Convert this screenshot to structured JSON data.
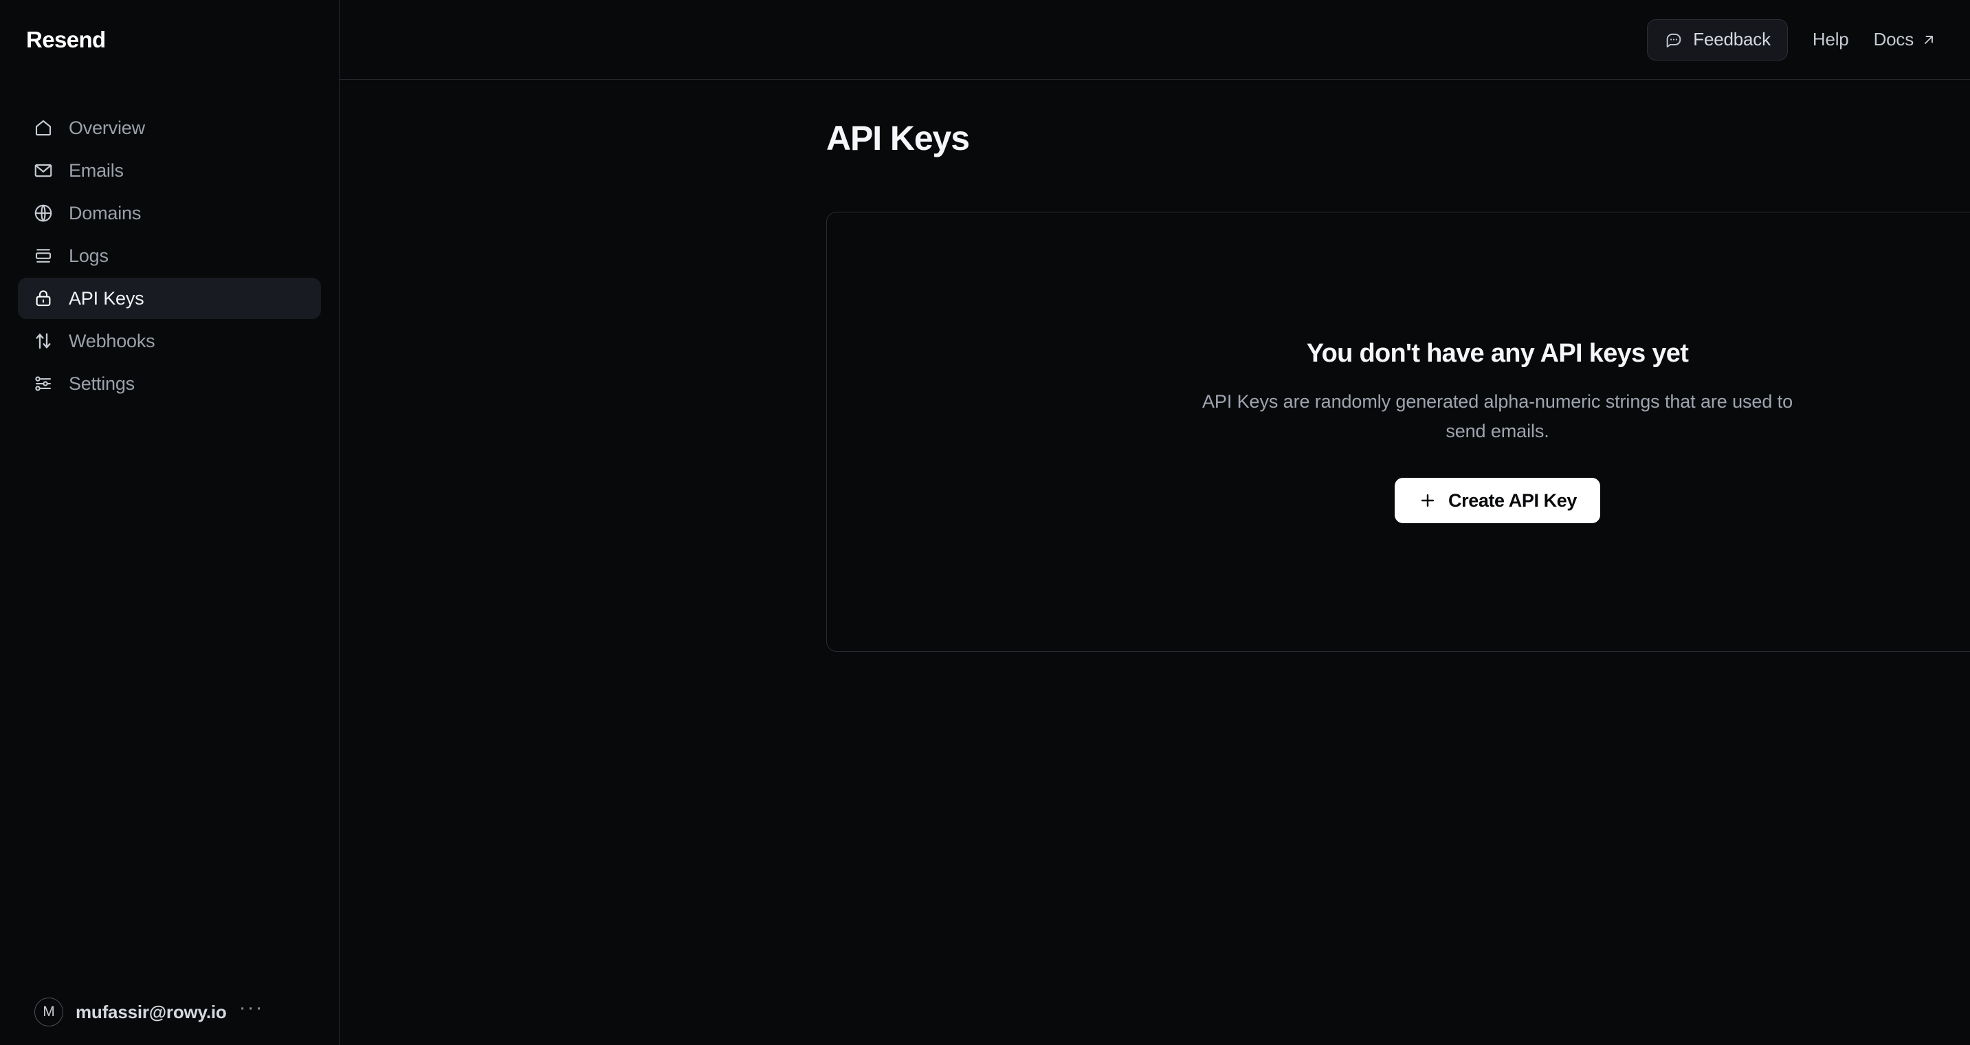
{
  "brand": {
    "name": "Resend"
  },
  "sidebar": {
    "items": [
      {
        "label": "Overview",
        "icon": "home-icon",
        "active": false
      },
      {
        "label": "Emails",
        "icon": "envelope-icon",
        "active": false
      },
      {
        "label": "Domains",
        "icon": "globe-icon",
        "active": false
      },
      {
        "label": "Logs",
        "icon": "logs-icon",
        "active": false
      },
      {
        "label": "API Keys",
        "icon": "lock-icon",
        "active": true
      },
      {
        "label": "Webhooks",
        "icon": "arrows-up-down-icon",
        "active": false
      },
      {
        "label": "Settings",
        "icon": "sliders-icon",
        "active": false
      }
    ],
    "user": {
      "avatar_initial": "M",
      "email": "mufassir@rowy.io",
      "more_label": "···"
    }
  },
  "topbar": {
    "feedback_label": "Feedback",
    "feedback_icon": "chat-bubble-dots-icon",
    "help_label": "Help",
    "docs_label": "Docs",
    "docs_icon": "arrow-up-right-icon"
  },
  "main": {
    "page_title": "API Keys",
    "empty_state": {
      "title": "You don't have any API keys yet",
      "description": "API Keys are randomly generated alpha-numeric strings that are used to send emails.",
      "cta_label": "Create API Key",
      "cta_icon": "plus-icon"
    }
  },
  "colors": {
    "background": "#08090b",
    "border": "#26282f",
    "active_nav_bg": "#191b22",
    "text_primary": "#f4f6f9",
    "text_muted": "#9ba1ab",
    "cta_bg": "#ffffff"
  }
}
